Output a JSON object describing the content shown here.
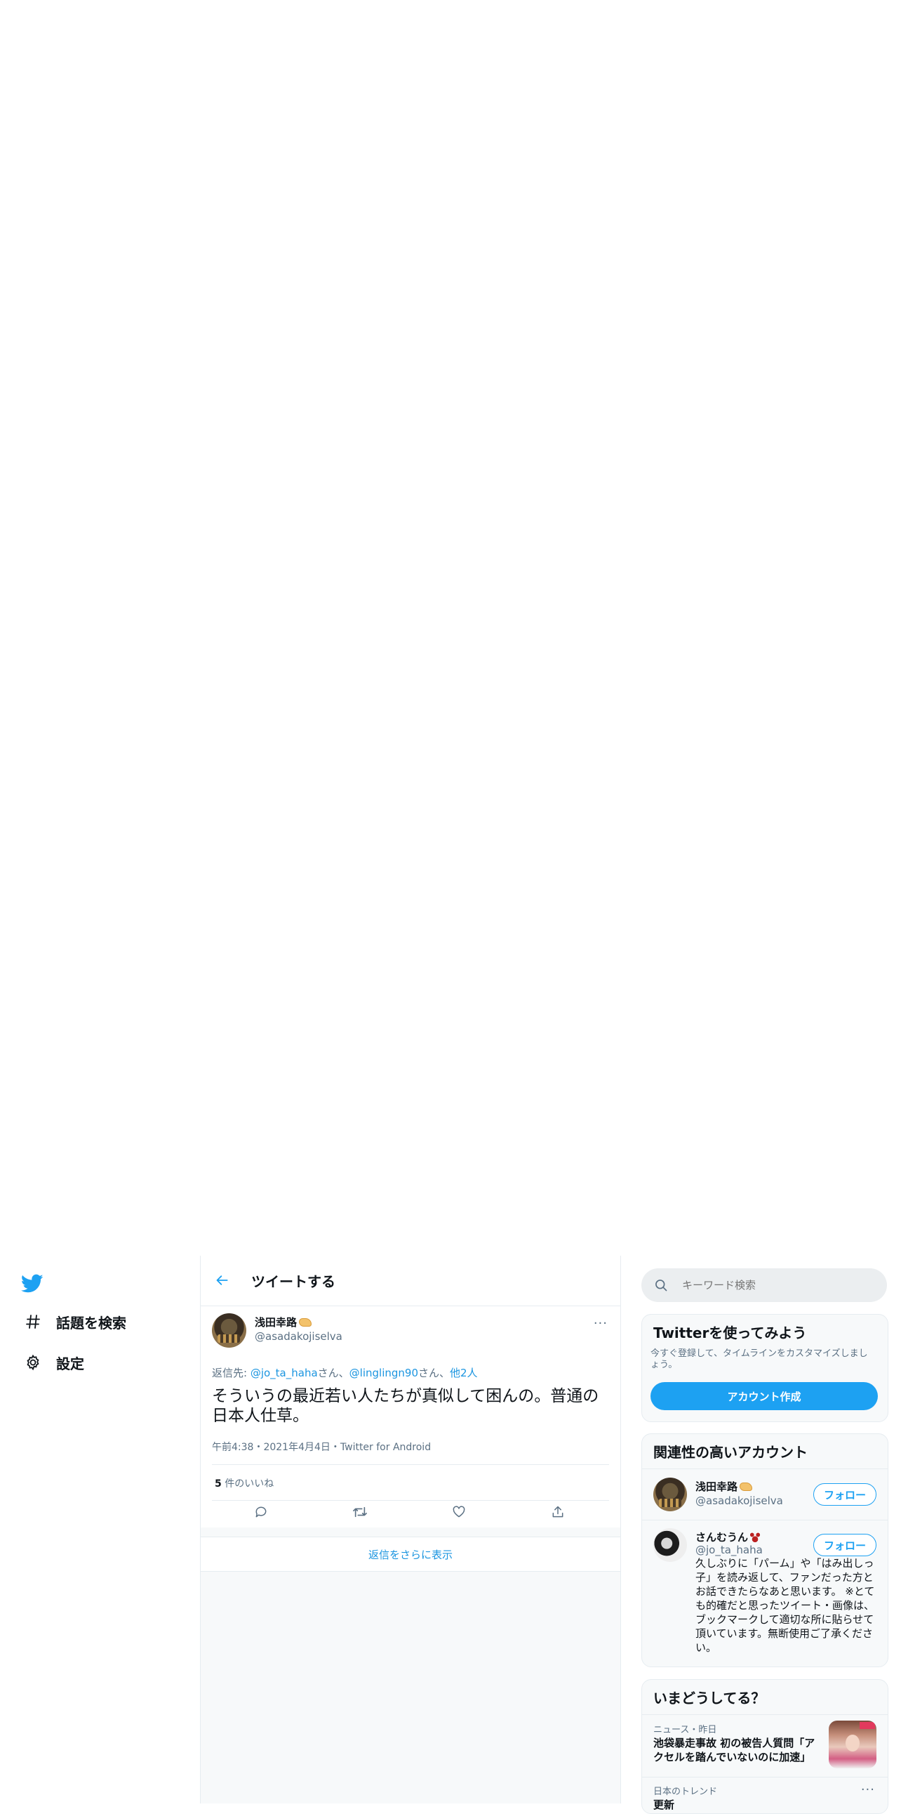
{
  "sidebar": {
    "logo_icon": "twitter-bird-icon",
    "items": [
      {
        "icon": "hashtag-icon",
        "label": "話題を検索"
      },
      {
        "icon": "gear-icon",
        "label": "設定"
      }
    ]
  },
  "header": {
    "back_icon": "arrow-left-icon",
    "title": "ツイートする"
  },
  "tweet": {
    "author_name": "浅田幸路",
    "author_handle": "@asadakojiselva",
    "reply_prefix": "返信先: ",
    "reply_user1": "@jo_ta_haha",
    "reply_san1": "さん、",
    "reply_user2": "@linglingn90",
    "reply_san2": "さん、",
    "reply_others": "他2人",
    "text": "そういうの最近若い人たちが真似して困んの。普通の日本人仕草。",
    "meta": "午前4:38・2021年4月4日・Twitter for Android",
    "likes_count": "5",
    "likes_label": " 件のいいね",
    "more": "···"
  },
  "more_replies": "返信をさらに表示",
  "search": {
    "placeholder": "キーワード検索"
  },
  "signup_card": {
    "title": "Twitterを使ってみよう",
    "description": "今すぐ登録して、タイムラインをカスタマイズしましょう。",
    "button": "アカウント作成"
  },
  "related": {
    "title": "関連性の高いアカウント",
    "accounts": [
      {
        "name": "浅田幸路",
        "handle": "@asadakojiselva",
        "follow": "フォロー"
      },
      {
        "name": "さんむうん",
        "handle": "@jo_ta_haha",
        "follow": "フォロー",
        "bio": "久しぶりに「パーム」や「はみ出しっ子」を読み返して、ファンだった方とお話できたらなあと思います。 ※とても的確だと思ったツイート・画像は、ブックマークして適切な所に貼らせて頂いています。無断使用ご了承ください。"
      }
    ]
  },
  "trends": {
    "title": "いまどうしてる？",
    "items": [
      {
        "meta": "ニュース・昨日",
        "text": "池袋暴走事故 初の被告人質問「アクセルを踏んでいないのに加速」"
      },
      {
        "meta": "日本のトレンド",
        "text": "更新",
        "more": "···"
      }
    ]
  },
  "colors": {
    "accent": "#1da1f2",
    "link": "#1b95e0",
    "muted": "#5b7083",
    "border": "#e6ecf0"
  }
}
